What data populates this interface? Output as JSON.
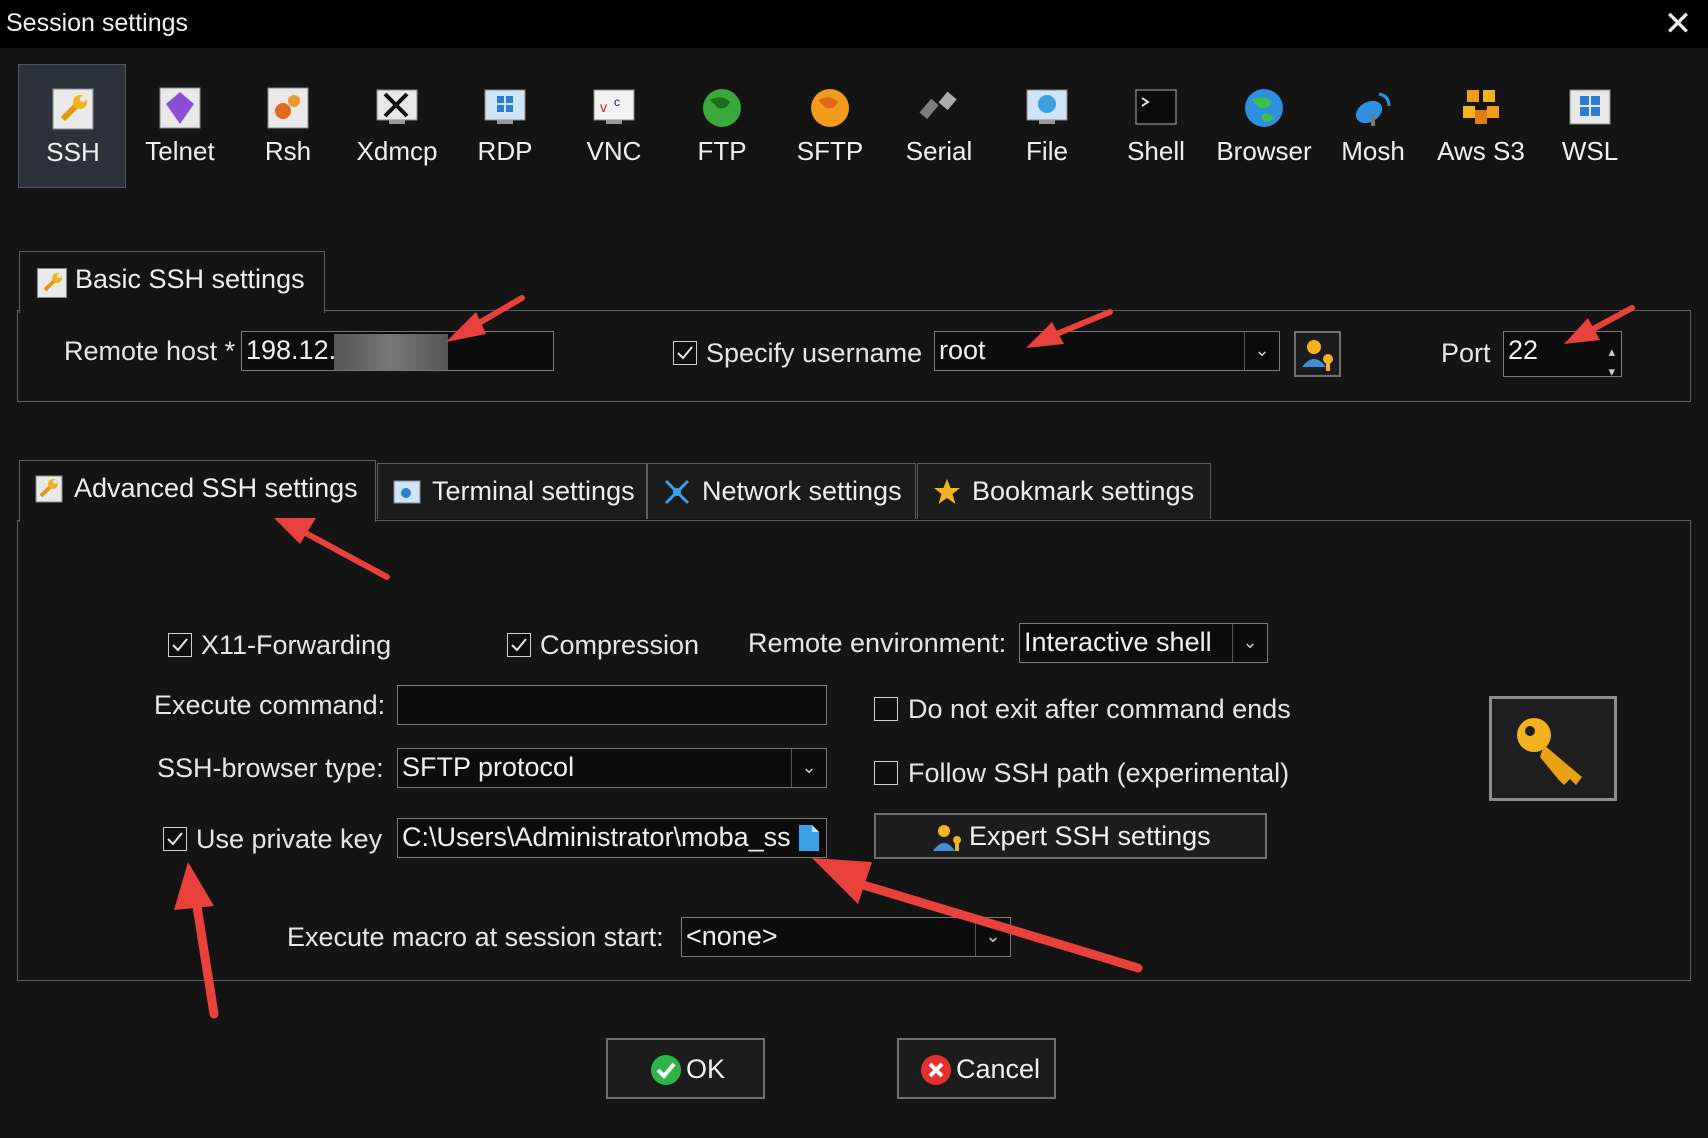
{
  "window": {
    "title": "Session settings"
  },
  "session_types": [
    {
      "label": "SSH",
      "icon": "ssh-wrench-icon",
      "selected": true
    },
    {
      "label": "Telnet",
      "icon": "telnet-gem-icon",
      "selected": false
    },
    {
      "label": "Rsh",
      "icon": "rsh-gears-icon",
      "selected": false
    },
    {
      "label": "Xdmcp",
      "icon": "xdmcp-x-icon",
      "selected": false
    },
    {
      "label": "RDP",
      "icon": "rdp-windows-icon",
      "selected": false
    },
    {
      "label": "VNC",
      "icon": "vnc-monitor-icon",
      "selected": false
    },
    {
      "label": "FTP",
      "icon": "ftp-globe-icon",
      "selected": false
    },
    {
      "label": "SFTP",
      "icon": "sftp-globe-icon",
      "selected": false
    },
    {
      "label": "Serial",
      "icon": "serial-plug-icon",
      "selected": false
    },
    {
      "label": "File",
      "icon": "file-monitor-icon",
      "selected": false
    },
    {
      "label": "Shell",
      "icon": "shell-terminal-icon",
      "selected": false
    },
    {
      "label": "Browser",
      "icon": "browser-globe-icon",
      "selected": false
    },
    {
      "label": "Mosh",
      "icon": "mosh-satellite-icon",
      "selected": false
    },
    {
      "label": "Aws S3",
      "icon": "aws-s3-cubes-icon",
      "selected": false
    },
    {
      "label": "WSL",
      "icon": "wsl-windows-icon",
      "selected": false
    }
  ],
  "basic": {
    "tab_label": "Basic SSH settings",
    "remote_host_label": "Remote host *",
    "remote_host_value": "198.12.",
    "specify_username_label": "Specify username",
    "specify_username_checked": true,
    "username_value": "root",
    "port_label": "Port",
    "port_value": "22"
  },
  "tabs": [
    {
      "label": "Advanced SSH settings",
      "icon": "wrench-icon",
      "active": true
    },
    {
      "label": "Terminal settings",
      "icon": "terminal-settings-icon",
      "active": false
    },
    {
      "label": "Network settings",
      "icon": "network-icon",
      "active": false
    },
    {
      "label": "Bookmark settings",
      "icon": "star-icon",
      "active": false
    }
  ],
  "advanced": {
    "x11_label": "X11-Forwarding",
    "x11_checked": true,
    "compression_label": "Compression",
    "compression_checked": true,
    "remote_env_label": "Remote environment:",
    "remote_env_value": "Interactive shell",
    "execute_command_label": "Execute command:",
    "execute_command_value": "",
    "do_not_exit_label": "Do not exit after command ends",
    "do_not_exit_checked": false,
    "ssh_browser_label": "SSH-browser type:",
    "ssh_browser_value": "SFTP protocol",
    "follow_path_label": "Follow SSH path (experimental)",
    "follow_path_checked": false,
    "private_key_label": "Use private key",
    "private_key_checked": true,
    "private_key_value": "C:\\Users\\Administrator\\moba_ss",
    "expert_button_label": "Expert SSH settings",
    "macro_label": "Execute macro at session start:",
    "macro_value": "<none>"
  },
  "buttons": {
    "ok": "OK",
    "cancel": "Cancel"
  },
  "colors": {
    "background": "#141414",
    "selected_tile": "#2c323b",
    "annotation_arrow": "#e8403a",
    "key_gold": "#f2b320"
  }
}
